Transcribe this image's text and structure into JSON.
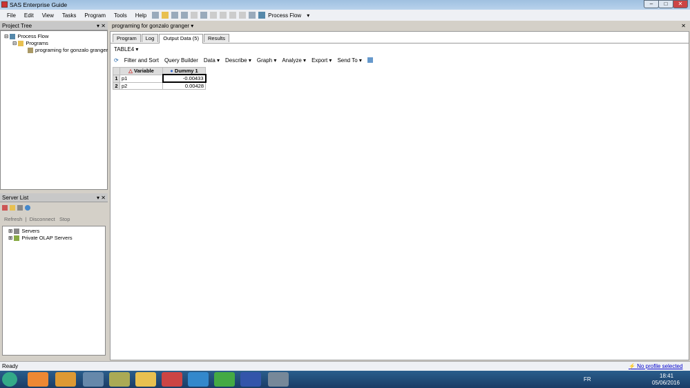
{
  "app": {
    "title": "SAS Enterprise Guide"
  },
  "menu": [
    "File",
    "Edit",
    "View",
    "Tasks",
    "Program",
    "Tools",
    "Help"
  ],
  "toolbar": {
    "process_flow": "Process Flow"
  },
  "project_tree": {
    "title": "Project Tree",
    "items": [
      "Process Flow",
      "Programs",
      "programing for gonzalo granger"
    ]
  },
  "server_list": {
    "title": "Server List",
    "refresh": "Refresh",
    "disconnect": "Disconnect",
    "stop": "Stop",
    "items": [
      "Servers",
      "Private OLAP Servers"
    ]
  },
  "doc": {
    "title": "programing for gonzalo granger",
    "tabs": [
      "Program",
      "Log",
      "Output Data (5)",
      "Results"
    ],
    "table_name": "TABLE4",
    "toolbar": [
      "Filter and Sort",
      "Query Builder",
      "Data",
      "Describe",
      "Graph",
      "Analyze",
      "Export",
      "Send To"
    ],
    "columns": [
      "Variable",
      "Dummy 1"
    ],
    "rows": [
      {
        "n": "1",
        "var": "p1",
        "val": "-0.00433"
      },
      {
        "n": "2",
        "var": "p2",
        "val": "0.00428"
      }
    ]
  },
  "status": {
    "text": "Ready",
    "profile": "No profile selected"
  },
  "taskbar": {
    "lang": "FR",
    "time": "18:41",
    "date": "05/06/2016"
  }
}
